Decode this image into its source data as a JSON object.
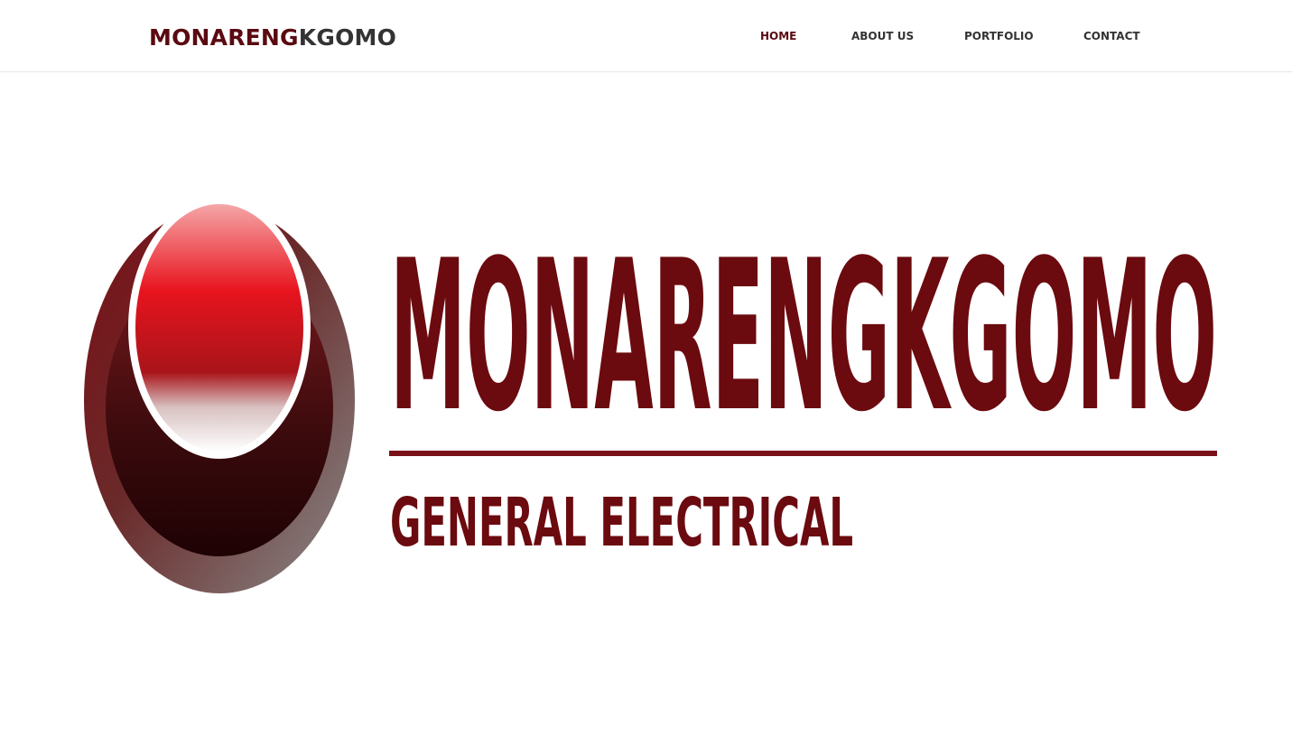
{
  "brand": {
    "part1": "MONARENG",
    "part2": "KGOMO"
  },
  "nav": {
    "items": [
      {
        "label": "HOME",
        "active": true
      },
      {
        "label": "ABOUT US",
        "active": false
      },
      {
        "label": "PORTFOLIO",
        "active": false
      },
      {
        "label": "CONTACT",
        "active": false
      }
    ]
  },
  "hero": {
    "logo_title": "MONARENGKGOMO",
    "logo_subtitle": "GENERAL ELECTRICAL"
  },
  "colors": {
    "brand_dark_red": "#5a0a10",
    "logo_red": "#6b0a0f",
    "text_dark": "#333333"
  }
}
